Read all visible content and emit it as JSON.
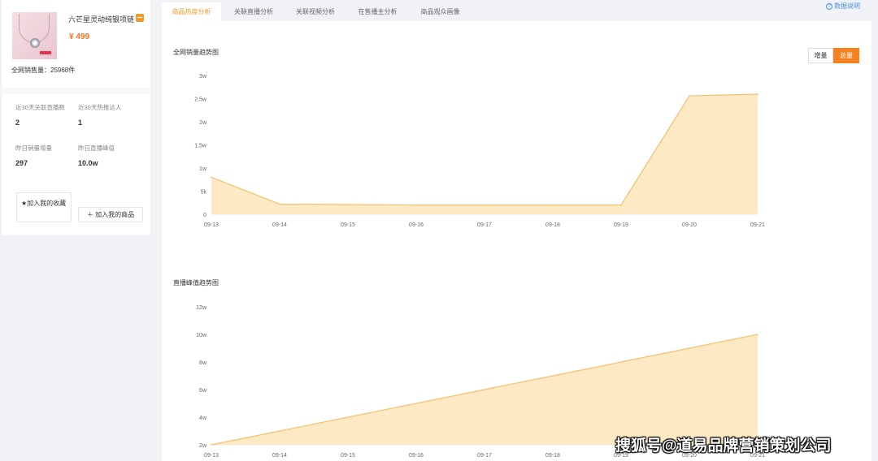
{
  "product": {
    "title": "六芒星灵动纯银项链",
    "price": "¥ 499",
    "total_sales": "全网销售量：25968件",
    "image_icon": "necklace-image",
    "badge_icon": "badge-icon"
  },
  "stats": [
    {
      "label": "近30天关联直播数",
      "value": "2"
    },
    {
      "label": "近30天热推达人",
      "value": "1"
    },
    {
      "label": "昨日销量增量",
      "value": "297"
    },
    {
      "label": "昨日直播峰值",
      "value": "10.0w"
    }
  ],
  "actions": {
    "favorite": "加入我的收藏",
    "favorite_icon": "star-icon",
    "add_product": "加入我的商品",
    "add_icon": "plus-icon"
  },
  "tabs": [
    {
      "label": "商品热度分析",
      "active": true
    },
    {
      "label": "关联直播分析",
      "active": false
    },
    {
      "label": "关联视频分析",
      "active": false
    },
    {
      "label": "在售播主分析",
      "active": false
    },
    {
      "label": "商品观众画像",
      "active": false
    }
  ],
  "help": {
    "label": "数据说明",
    "icon": "question-circle-icon"
  },
  "toggle": {
    "increment": "增量",
    "total": "总量",
    "selected": "总量"
  },
  "colors": {
    "accent": "#f5821f",
    "area_fill": "#fde9c4",
    "area_line": "#f5c16c",
    "link": "#4a90e2"
  },
  "chart_data": [
    {
      "type": "area",
      "title": "全网销量趋势图",
      "x": [
        "09-13",
        "09-14",
        "09-15",
        "09-16",
        "09-17",
        "09-18",
        "09-19",
        "09-20",
        "09-21"
      ],
      "values": [
        8000,
        2200,
        2100,
        2000,
        2000,
        2000,
        2000,
        25600,
        25968
      ],
      "ylim": [
        0,
        30000
      ],
      "yticks": [
        0,
        5000,
        10000,
        15000,
        20000,
        25000,
        30000
      ],
      "ytick_labels": [
        "0",
        "5k",
        "1w",
        "1.5w",
        "2w",
        "2.5w",
        "3w"
      ],
      "grid": false,
      "legend": "none"
    },
    {
      "type": "area",
      "title": "直播峰值趋势图",
      "x": [
        "09-13",
        "09-14",
        "09-15",
        "09-16",
        "09-17",
        "09-18",
        "09-19",
        "09-20",
        "09-21"
      ],
      "values": [
        20000,
        30000,
        40000,
        50000,
        60000,
        70000,
        80000,
        90000,
        100000
      ],
      "ylim": [
        20000,
        120000
      ],
      "yticks": [
        20000,
        40000,
        60000,
        80000,
        100000,
        120000
      ],
      "ytick_labels": [
        "2w",
        "4w",
        "6w",
        "8w",
        "10w",
        "12w"
      ],
      "grid": false,
      "legend": "none"
    }
  ],
  "watermark": "搜狐号@道易品牌营销策划公司"
}
